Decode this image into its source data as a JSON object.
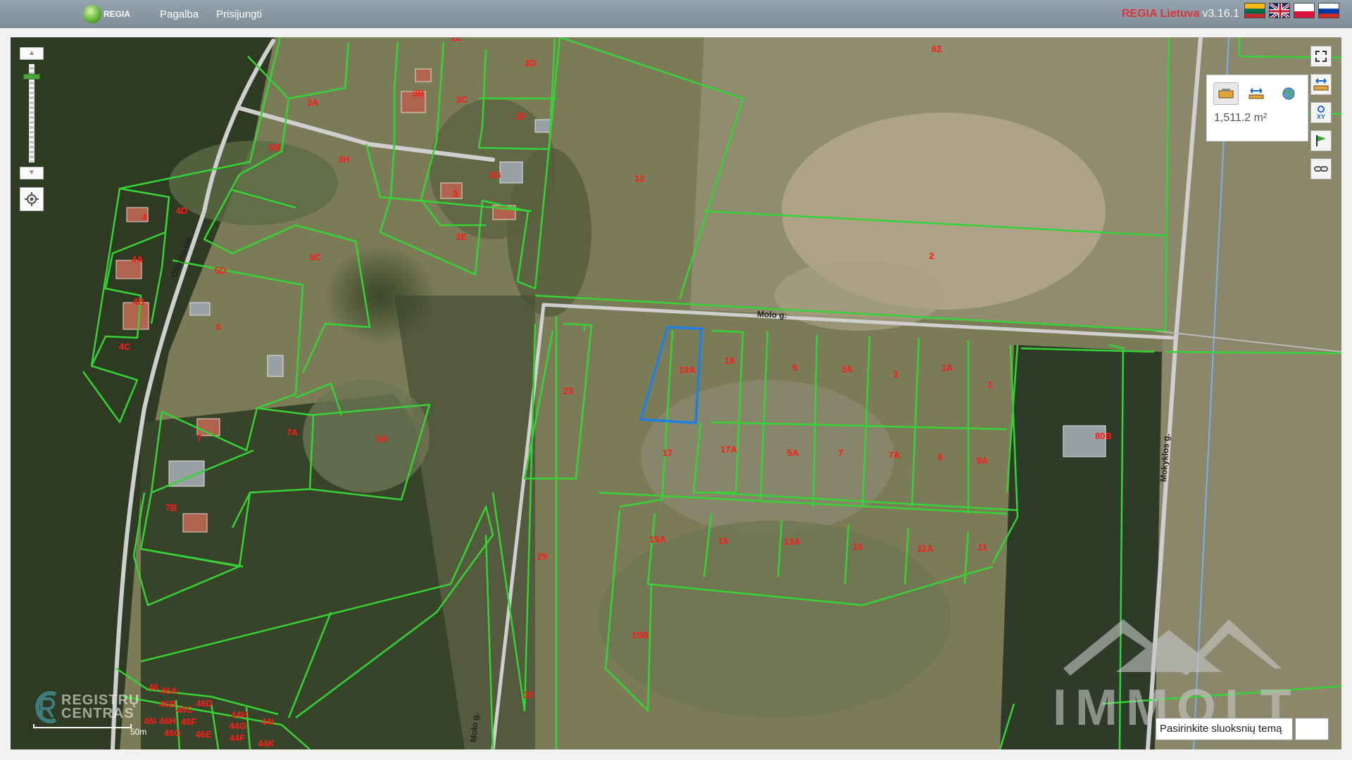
{
  "header": {
    "logo_text": "REGIA",
    "nav": [
      "Pagalba",
      "Prisijungti"
    ],
    "app_name": "REGIA Lietuva",
    "version": "v3.16.1",
    "languages": [
      "lt",
      "en",
      "pl",
      "ru"
    ]
  },
  "map": {
    "streets": [
      "Ošupio tak.",
      "Molo g.",
      "Molo g.",
      "Mokyklos g."
    ],
    "parcels": [
      "1L",
      "3D",
      "62",
      "3B",
      "3C",
      "3A",
      "3F",
      "5B",
      "3H",
      "3G",
      "12",
      "3",
      "4",
      "4D",
      "3E",
      "4A",
      "5D",
      "5C",
      "2",
      "4B",
      "5",
      "4C",
      "19A",
      "19",
      "5",
      "3A",
      "3",
      "1A",
      "1",
      "23",
      "7",
      "7A",
      "5A",
      "17",
      "17A",
      "5A",
      "7",
      "7A",
      "9",
      "9A",
      "80B",
      "7B",
      "15A",
      "15",
      "13A",
      "13",
      "11A",
      "11",
      "29",
      "15B",
      "35",
      "46",
      "46A",
      "46B",
      "46D",
      "46C",
      "46I",
      "46H",
      "46F",
      "46G",
      "46E",
      "44H",
      "44I",
      "44G",
      "44F",
      "44K"
    ],
    "selected_parcel": "19A",
    "measure": {
      "area": "1,511.2 m²",
      "tools": [
        "parcel-info-icon",
        "measure-distance-icon",
        "globe-icon"
      ]
    },
    "right_tools": [
      "fullscreen-icon",
      "measure-icon",
      "coordinates-icon",
      "flag-icon",
      "link-icon"
    ],
    "layer_input_value": "Pasirinkite sluoksnių temą",
    "scale_label": "50m",
    "registry_logo": [
      "REGISTRŲ",
      "CENTRAS"
    ],
    "watermark": "IMMOLT",
    "colors": {
      "parcel": "#35d335",
      "selection": "#1e7fe0",
      "label": "#ff1a1a"
    }
  }
}
